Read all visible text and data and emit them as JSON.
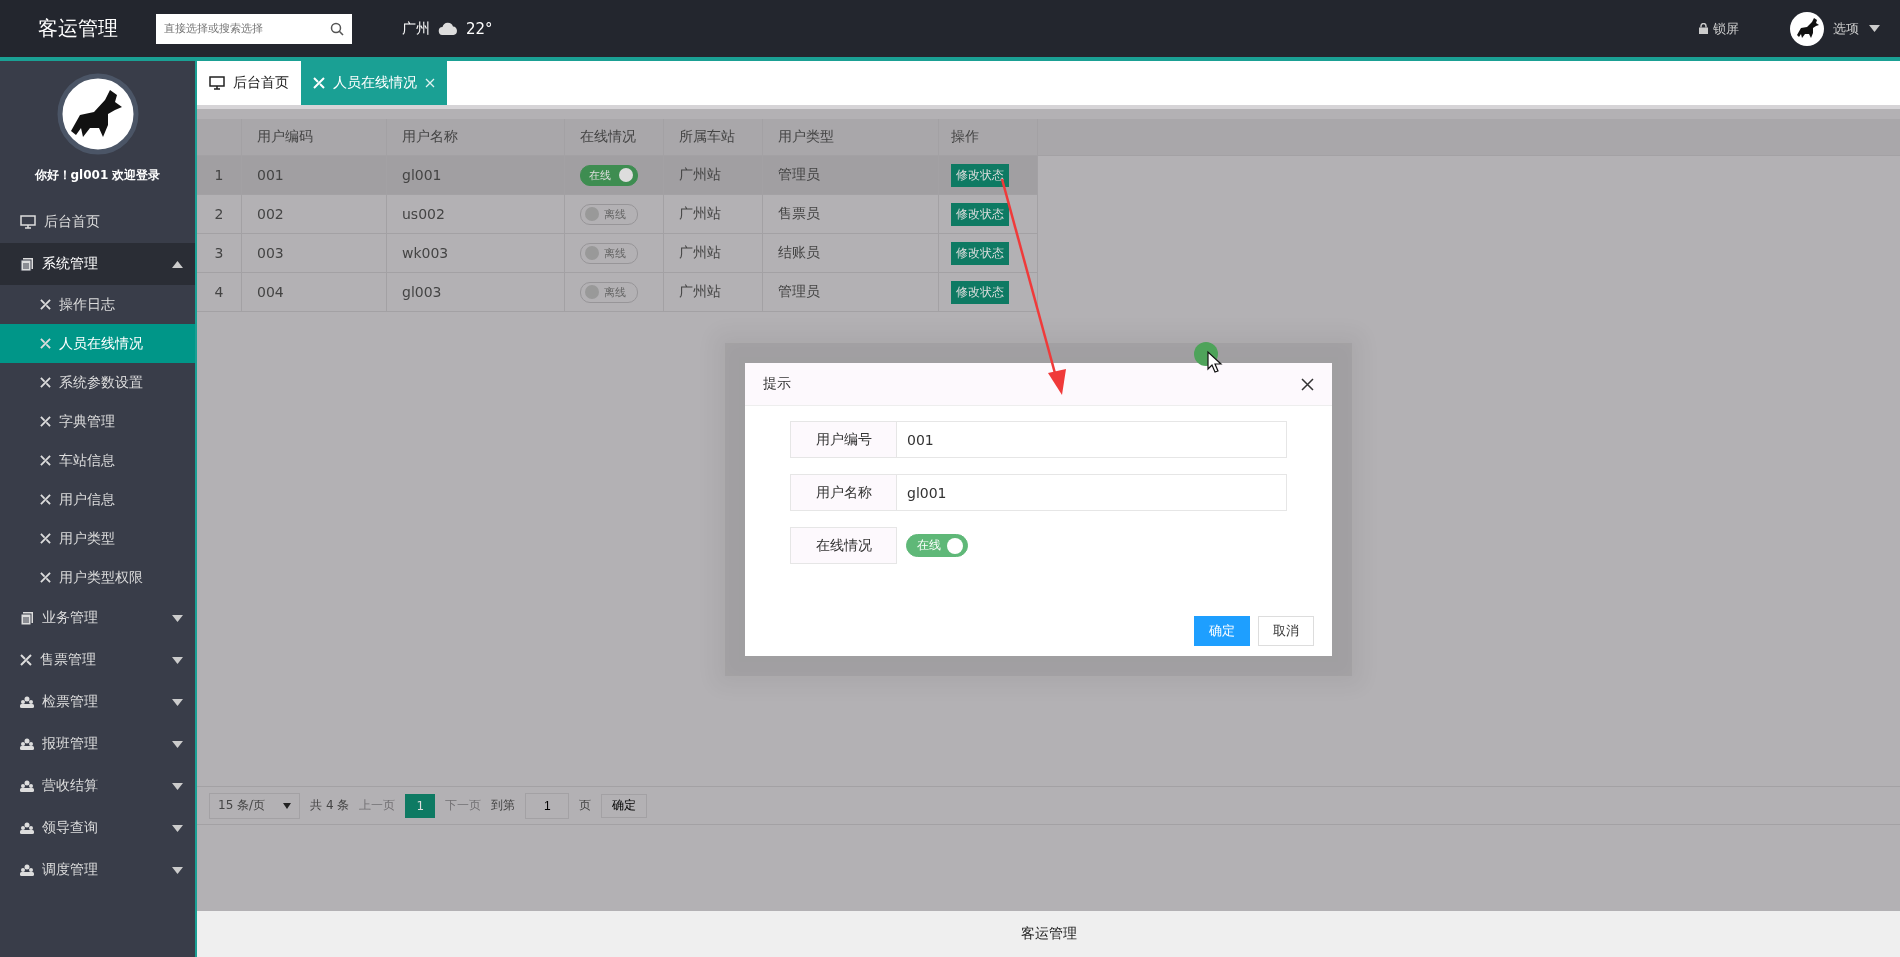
{
  "header": {
    "title": "客运管理",
    "search": {
      "placeholder": "直接选择或搜索选择"
    },
    "weather": {
      "city": "广州",
      "temperature": "22°"
    },
    "lock": "锁屏",
    "options": "选项"
  },
  "sidebar": {
    "greeting": "你好！gl001 欢迎登录",
    "items": [
      {
        "kind": "home",
        "label": "后台首页"
      },
      {
        "kind": "folder",
        "label": "系统管理",
        "expanded": true,
        "children": [
          {
            "label": "操作日志",
            "selected": false
          },
          {
            "label": "人员在线情况",
            "selected": true
          },
          {
            "label": "系统参数设置",
            "selected": false
          },
          {
            "label": "字典管理",
            "selected": false
          },
          {
            "label": "车站信息",
            "selected": false
          },
          {
            "label": "用户信息",
            "selected": false
          },
          {
            "label": "用户类型",
            "selected": false
          },
          {
            "label": "用户类型权限",
            "selected": false
          }
        ]
      },
      {
        "kind": "folder",
        "label": "业务管理",
        "expanded": false
      },
      {
        "kind": "tool",
        "label": "售票管理",
        "expanded": false
      },
      {
        "kind": "group",
        "label": "检票管理",
        "expanded": false
      },
      {
        "kind": "group",
        "label": "报班管理",
        "expanded": false
      },
      {
        "kind": "group",
        "label": "营收结算",
        "expanded": false
      },
      {
        "kind": "group",
        "label": "领导查询",
        "expanded": false
      },
      {
        "kind": "group",
        "label": "调度管理",
        "expanded": false
      }
    ]
  },
  "tabs": [
    {
      "kind": "home",
      "label": "后台首页",
      "selected": false,
      "closable": false
    },
    {
      "kind": "tool",
      "label": "人员在线情况",
      "selected": true,
      "closable": true
    }
  ],
  "table": {
    "columns": [
      "用户编码",
      "用户名称",
      "在线情况",
      "所属车站",
      "用户类型",
      "操作"
    ],
    "rows": [
      {
        "index": "1",
        "code": "001",
        "name": "gl001",
        "online": true,
        "status": "在线",
        "station": "广州站",
        "type": "管理员",
        "action": "修改状态",
        "selected": true
      },
      {
        "index": "2",
        "code": "002",
        "name": "us002",
        "online": false,
        "status": "离线",
        "station": "广州站",
        "type": "售票员",
        "action": "修改状态",
        "selected": false
      },
      {
        "index": "3",
        "code": "003",
        "name": "wk003",
        "online": false,
        "status": "离线",
        "station": "广州站",
        "type": "结账员",
        "action": "修改状态",
        "selected": false
      },
      {
        "index": "4",
        "code": "004",
        "name": "gl003",
        "online": false,
        "status": "离线",
        "station": "广州站",
        "type": "管理员",
        "action": "修改状态",
        "selected": false
      }
    ]
  },
  "pagination": {
    "page_size": "15 条/页",
    "total": "共 4 条",
    "prev": {
      "label": "上一页",
      "disabled": true
    },
    "pages": [
      {
        "label": "1",
        "selected": true
      }
    ],
    "next": {
      "label": "下一页",
      "disabled": true
    },
    "goto": "到第",
    "goto_value": "1",
    "page_unit": "页",
    "confirm": "确定"
  },
  "dialog": {
    "title": "提示",
    "fields": [
      {
        "kind": "text",
        "label": "用户编号",
        "value": "001"
      },
      {
        "kind": "text",
        "label": "用户名称",
        "value": "gl001"
      },
      {
        "kind": "switch",
        "label": "在线情况",
        "on": true,
        "text": "在线"
      }
    ],
    "buttons": [
      {
        "label": "确定",
        "primary": true
      },
      {
        "label": "取消",
        "primary": false
      }
    ]
  },
  "footer": "客运管理"
}
